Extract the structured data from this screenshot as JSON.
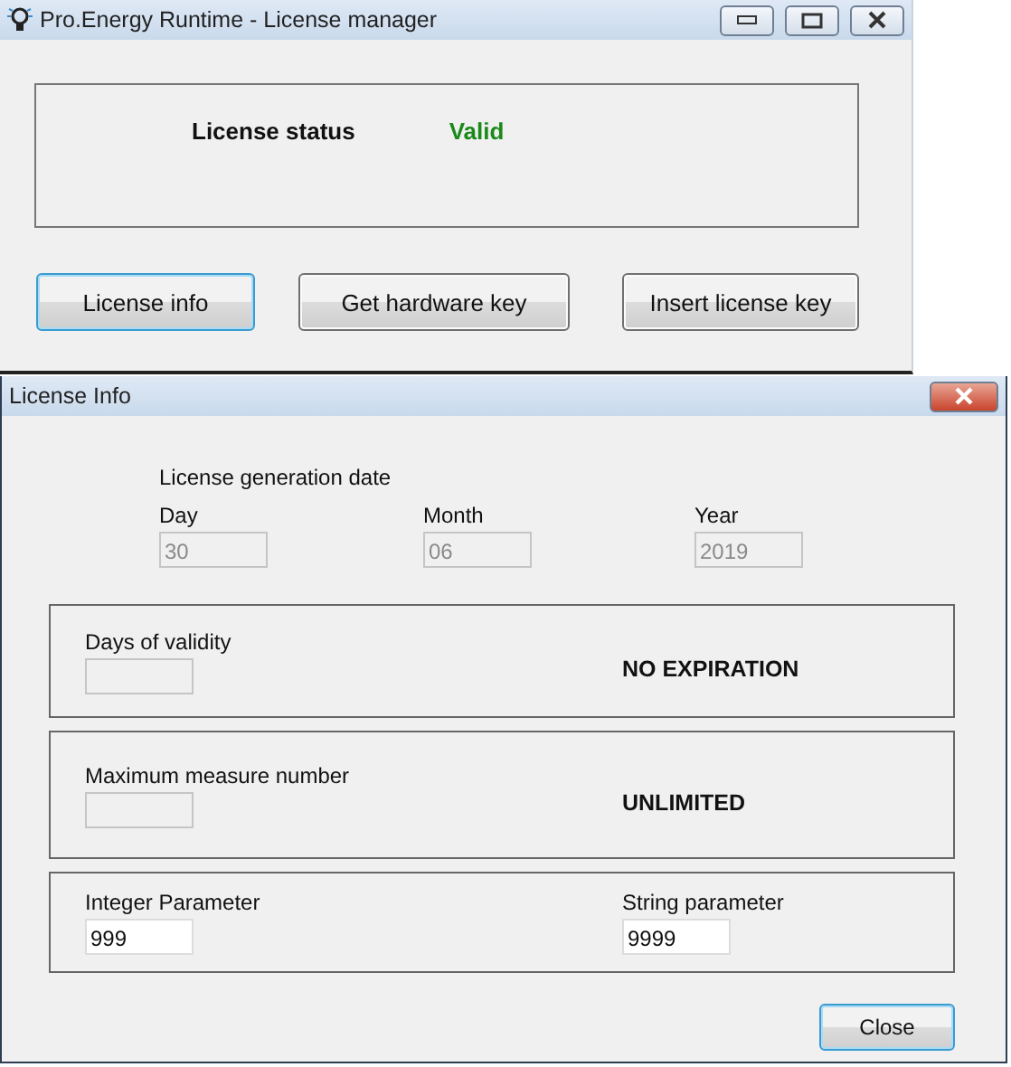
{
  "main_window": {
    "title": "Pro.Energy Runtime - License manager",
    "status": {
      "label": "License status",
      "value": "Valid",
      "valid": true
    },
    "buttons": [
      {
        "label": "License info",
        "focused": true
      },
      {
        "label": "Get hardware key",
        "focused": false
      },
      {
        "label": "Insert license key",
        "focused": false
      }
    ]
  },
  "dialog": {
    "title": "License Info",
    "date": {
      "heading": "License generation date",
      "fields": [
        {
          "label": "Day",
          "value": "30",
          "disabled": true
        },
        {
          "label": "Month",
          "value": "06",
          "disabled": true
        },
        {
          "label": "Year",
          "value": "2019",
          "disabled": true
        }
      ]
    },
    "sections": [
      {
        "fields": [
          {
            "label": "Days of validity",
            "disabled": true
          }
        ],
        "note": "NO EXPIRATION"
      },
      {
        "fields": [
          {
            "label": "Maximum measure number",
            "disabled": true
          }
        ],
        "note": "UNLIMITED"
      },
      {
        "fields": [
          {
            "label": "Integer Parameter",
            "value": "999",
            "disabled": false
          },
          {
            "label": "String parameter",
            "value": "9999",
            "disabled": false
          }
        ]
      }
    ],
    "close_button": {
      "label": "Close",
      "focused": true
    }
  }
}
